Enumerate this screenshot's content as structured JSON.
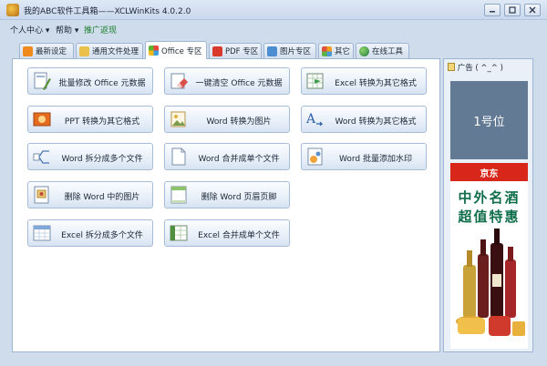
{
  "window": {
    "title": "我的ABC软件工具箱——XCLWinKits  4.0.2.0",
    "controls": [
      "minimize-icon",
      "restore-icon",
      "close-icon"
    ]
  },
  "menu": {
    "items": [
      "个人中心 ▾",
      "帮助 ▾",
      "推广返现"
    ]
  },
  "tabs": [
    {
      "label": "最新设定",
      "icon": "rss-icon"
    },
    {
      "label": "通用文件处理",
      "icon": "folder-icon"
    },
    {
      "label": "Office 专区",
      "icon": "office-icon",
      "active": true
    },
    {
      "label": "PDF 专区",
      "icon": "pdf-icon"
    },
    {
      "label": "图片专区",
      "icon": "image-icon"
    },
    {
      "label": "其它",
      "icon": "grid-icon"
    },
    {
      "label": "在线工具",
      "icon": "globe-icon"
    }
  ],
  "functions": [
    {
      "label": "批量修改 Office 元数据",
      "icon": "office-edit-icon"
    },
    {
      "label": "一键清空 Office 元数据",
      "icon": "eraser-icon"
    },
    {
      "label": "Excel 转换为其它格式",
      "icon": "excel-convert-icon"
    },
    {
      "label": "PPT 转换为其它格式",
      "icon": "ppt-icon"
    },
    {
      "label": "Word 转换为图片",
      "icon": "word-image-icon"
    },
    {
      "label": "Word 转换为其它格式",
      "icon": "font-convert-icon"
    },
    {
      "label": "Word 拆分成多个文件",
      "icon": "split-icon"
    },
    {
      "label": "Word 合并成单个文件",
      "icon": "merge-document-icon"
    },
    {
      "label": "Word 批量添加水印",
      "icon": "watermark-icon"
    },
    {
      "label": "删除 Word 中的图片",
      "icon": "delete-image-icon"
    },
    {
      "label": "删除 Word 页眉页脚",
      "icon": "header-footer-icon"
    },
    {
      "label": "Excel 拆分成多个文件",
      "icon": "excel-split-icon"
    },
    {
      "label": "Excel 合并成单个文件",
      "icon": "excel-merge-icon"
    }
  ],
  "ad": {
    "title": "广告 ( ^_^ )",
    "slot_text": "1号位",
    "banner": {
      "brand": "京东",
      "line1": "中外名酒",
      "line2": "超值特惠"
    }
  },
  "colors": {
    "window_bg": "#cfdcec",
    "panel_bg": "#ffffff",
    "ad_slot_bg": "#637a95",
    "jd_red": "#d8261b",
    "ad_text_green": "#0e6d4a"
  }
}
